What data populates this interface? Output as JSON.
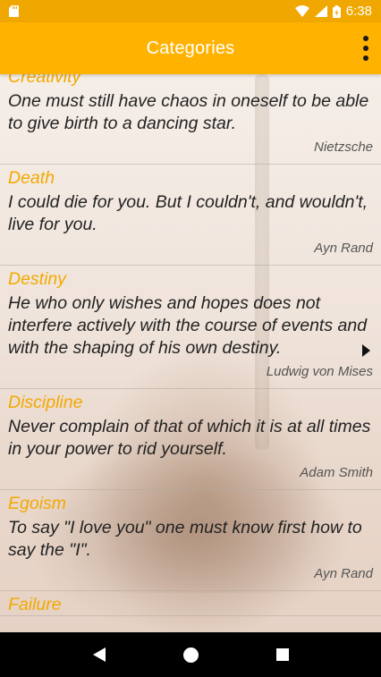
{
  "status": {
    "time": "6:38"
  },
  "app_bar": {
    "title": "Categories"
  },
  "quotes": [
    {
      "category": "Creativity",
      "text": "One must still have chaos in oneself to be able to give birth to a dancing star.",
      "author": "Nietzsche"
    },
    {
      "category": "Death",
      "text": "I could die for you. But I couldn't, and wouldn't, live for you.",
      "author": "Ayn Rand"
    },
    {
      "category": "Destiny",
      "text": "He who only wishes and hopes does not interfere actively with the course of events and with the shaping of his own destiny.",
      "author": "Ludwig von Mises"
    },
    {
      "category": "Discipline",
      "text": "Never complain of that of which it is at all times in your power to rid yourself.",
      "author": "Adam Smith"
    },
    {
      "category": "Egoism",
      "text": "To say \"I love you\" one must know first how to say the \"I\".",
      "author": "Ayn Rand"
    },
    {
      "category": "Failure",
      "text": "",
      "author": ""
    }
  ]
}
